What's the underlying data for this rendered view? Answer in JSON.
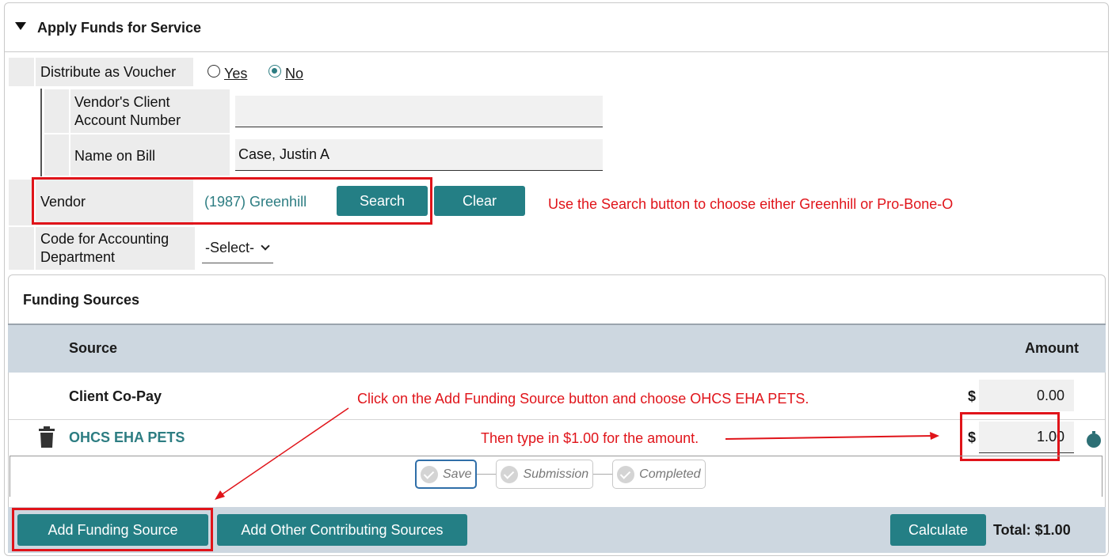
{
  "section": {
    "title": "Apply Funds for Service"
  },
  "voucher": {
    "label": "Distribute as Voucher",
    "options": [
      {
        "label": "Yes",
        "checked": false
      },
      {
        "label": "No",
        "checked": true
      }
    ]
  },
  "vendor_client": {
    "label_line1": "Vendor's Client",
    "label_line2": "Account Number",
    "value": ""
  },
  "name_on_bill": {
    "label": "Name on Bill",
    "value": "Case, Justin A"
  },
  "vendor": {
    "label": "Vendor",
    "value": "(1987) Greenhill",
    "search_label": "Search",
    "clear_label": "Clear",
    "note": "Use the Search button to choose either Greenhill or Pro-Bone-O"
  },
  "accounting_code": {
    "label_line1": "Code for Accounting",
    "label_line2": "Department",
    "selected": "-Select-"
  },
  "funding": {
    "title": "Funding Sources",
    "col_source": "Source",
    "col_amount": "Amount",
    "rows": [
      {
        "source": "Client Co-Pay",
        "currency": "$",
        "amount": "0.00"
      },
      {
        "source": "OHCS EHA PETS",
        "currency": "$",
        "amount": "1.00"
      }
    ],
    "note_add": "Click on the Add Funding Source button and choose OHCS EHA PETS.",
    "note_amount": "Then type in $1.00 for the amount.",
    "steps": [
      "Save",
      "Submission",
      "Completed"
    ],
    "add_funding_label": "Add Funding Source",
    "add_other_label": "Add Other Contributing Sources",
    "calculate_label": "Calculate",
    "total": "Total: $1.00"
  },
  "colors": {
    "accent": "#247f85",
    "annotation": "#e0141a"
  }
}
